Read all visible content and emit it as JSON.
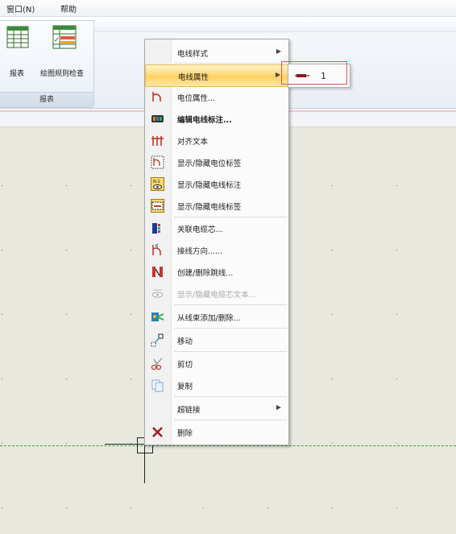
{
  "menubar": {
    "items": [
      "窗口(N)",
      "帮助"
    ]
  },
  "ribbon": {
    "buttons": [
      {
        "label": "报表",
        "icon": "report-table-icon"
      },
      {
        "label": "绘图规则检查",
        "icon": "drawing-rule-check-icon"
      }
    ],
    "group_label": "报表"
  },
  "context_menu": {
    "items": [
      {
        "label": "电线样式",
        "submenu": true,
        "icon": ""
      },
      {
        "label": "电线属性",
        "submenu": true,
        "icon": "",
        "highlighted": true
      },
      {
        "label": "电位属性...",
        "icon": "potential-icon"
      },
      {
        "label": "编辑电线标注...",
        "icon": "edit-wire-label-icon",
        "bold": true
      },
      {
        "label": "对齐文本",
        "icon": "align-text-icon"
      },
      {
        "label": "显示/隐藏电位标签",
        "icon": "toggle-potential-label-icon"
      },
      {
        "label": "显示/隐藏电线标注",
        "icon": "toggle-wire-annotation-icon"
      },
      {
        "label": "显示/隐藏电线标签",
        "icon": "toggle-wire-label-icon"
      },
      {
        "label": "关联电缆芯...",
        "icon": "cable-core-icon"
      },
      {
        "label": "接线方向......",
        "icon": "wiring-direction-icon"
      },
      {
        "label": "创建/删除跳线...",
        "icon": "jumper-icon"
      },
      {
        "label": "显示/隐藏电缆芯文本...",
        "icon": "toggle-cable-text-icon",
        "disabled": true
      },
      {
        "label": "从线束添加/删除...",
        "icon": "harness-icon"
      },
      {
        "label": "移动",
        "icon": "move-icon"
      },
      {
        "label": "剪切",
        "icon": "scissors-icon"
      },
      {
        "label": "复制",
        "icon": "copy-icon"
      },
      {
        "label": "超链接",
        "submenu": true,
        "icon": ""
      },
      {
        "label": "删除",
        "icon": "delete-x-icon"
      }
    ]
  },
  "submenu": {
    "label": "1",
    "icon": "wire-icon"
  }
}
